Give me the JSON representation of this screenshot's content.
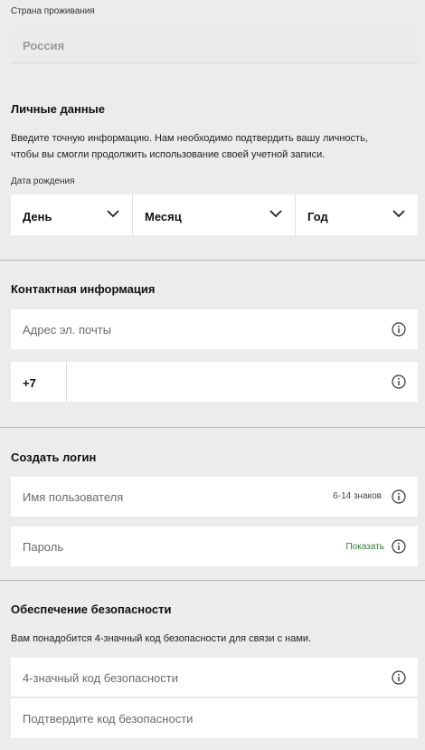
{
  "residence": {
    "label": "Страна проживания",
    "value": "Россия"
  },
  "personal": {
    "title": "Личные данные",
    "description_line1": "Введите точную информацию. Нам необходимо подтвердить вашу личность,",
    "description_line2": "чтобы вы смогли продолжить использование своей учетной записи.",
    "dob_label": "Дата рождения",
    "day": "День",
    "month": "Месяц",
    "year": "Год"
  },
  "contact": {
    "title": "Контактная информация",
    "email_placeholder": "Адрес эл. почты",
    "phone_prefix": "+7"
  },
  "login": {
    "title": "Создать логин",
    "username_placeholder": "Имя пользователя",
    "username_hint": "6-14 знаков",
    "password_placeholder": "Пароль",
    "show_password": "Показать"
  },
  "security": {
    "title": "Обеспечение безопасности",
    "description": "Вам понадобится 4-значный код безопасности для связи с нами.",
    "code_placeholder": "4-значный код безопасности",
    "confirm_placeholder": "Подтвердите код безопасности"
  },
  "colors": {
    "accent_green": "#2e7d32",
    "background": "#ececec"
  },
  "icons": {
    "info": "info-icon",
    "chevron": "chevron-down-icon"
  }
}
